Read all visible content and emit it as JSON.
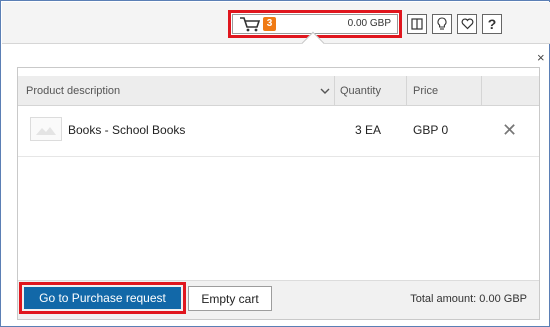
{
  "header": {
    "cart": {
      "count": "3",
      "amount": "0.00 GBP",
      "icon": "shopping-cart-icon"
    },
    "icons": [
      {
        "name": "compare-icon",
        "glyph": "◫"
      },
      {
        "name": "lightbulb-icon",
        "glyph": "💡"
      },
      {
        "name": "heart-icon",
        "glyph": "♡"
      },
      {
        "name": "help-icon",
        "glyph": "?"
      }
    ],
    "close_glyph": "×"
  },
  "table": {
    "columns": {
      "description": "Product description",
      "quantity": "Quantity",
      "price": "Price"
    },
    "rows": [
      {
        "description": "Books - School Books",
        "quantity": "3 EA",
        "price": "GBP 0",
        "delete_glyph": "✕"
      }
    ]
  },
  "footer": {
    "go_label": "Go to Purchase request",
    "empty_label": "Empty cart",
    "total": "Total amount: 0.00 GBP"
  },
  "colors": {
    "primary": "#1268a8",
    "highlight": "#e0161e",
    "badge": "#f07a14"
  }
}
